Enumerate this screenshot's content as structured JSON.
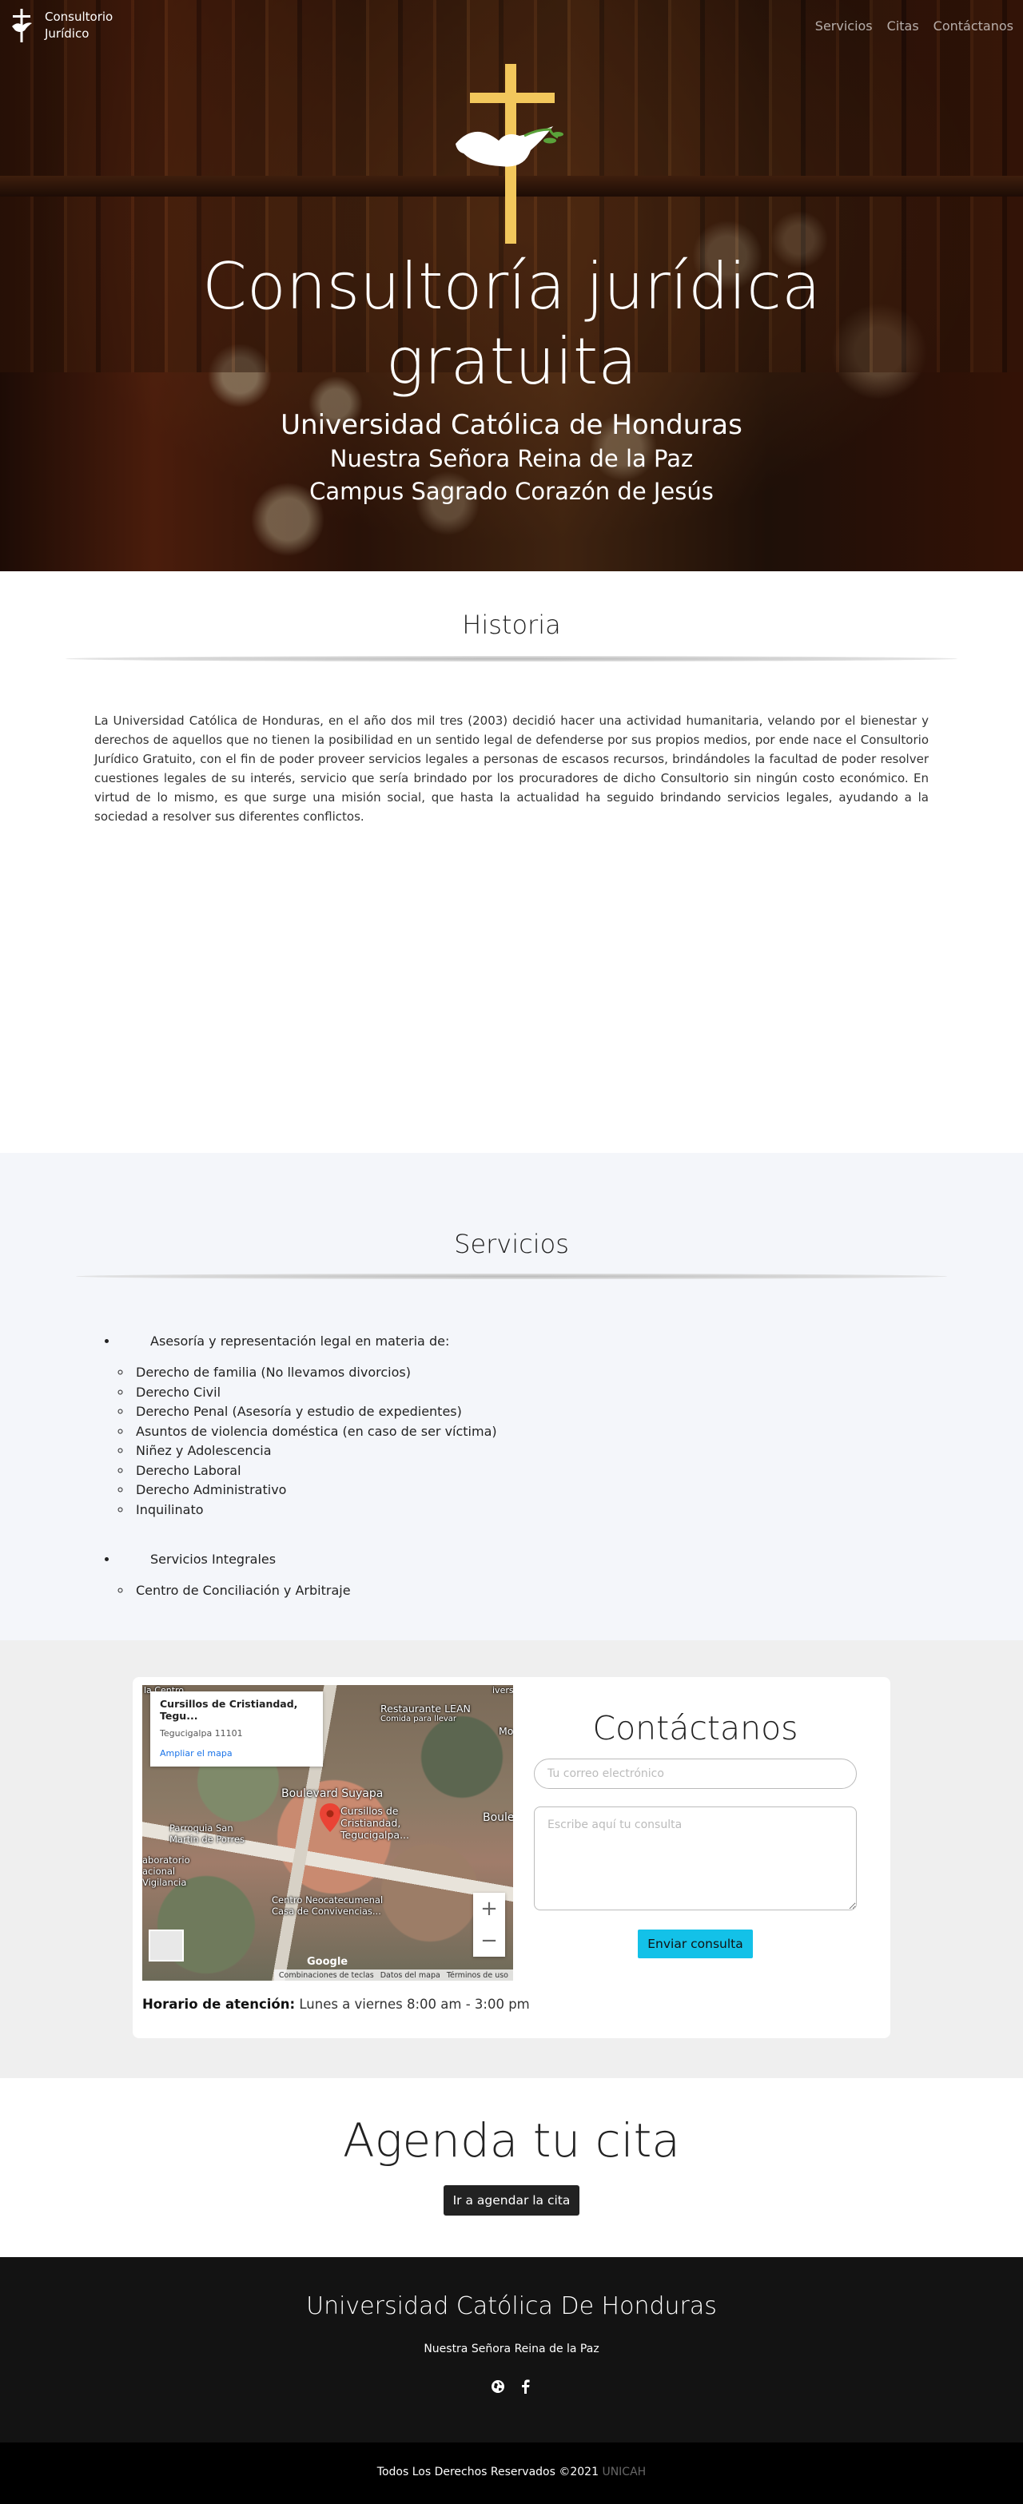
{
  "nav": {
    "brand": "Consultorio Jurídico",
    "links": [
      "Servicios",
      "Citas",
      "Contáctanos"
    ]
  },
  "hero": {
    "title": "Consultoría jurídica gratuita",
    "line1": "Universidad Católica de Honduras",
    "line2": "Nuestra Señora Reina de la Paz",
    "line3": "Campus Sagrado Corazón de Jesús"
  },
  "historia": {
    "title": "Historia",
    "text": "La Universidad Católica de Honduras, en el año dos mil tres (2003) decidió hacer una actividad humanitaria, velando por el bienestar y derechos de aquellos que no tienen la posibilidad en un sentido legal de defenderse por sus propios medios, por ende nace el Consultorio Jurídico Gratuito, con el fin de poder proveer servicios legales a personas de escasos recursos, brindándoles la facultad de poder resolver cuestiones legales de su interés, servicio que sería brindado por los procuradores de dicho Consultorio sin ningún costo económico. En virtud de lo mismo, es que surge una misión social, que hasta la actualidad ha seguido brindando servicios legales, ayudando a la sociedad a resolver sus diferentes conflictos."
  },
  "servicios": {
    "title": "Servicios",
    "groups": [
      {
        "label": "Asesoría y representación legal en materia de:",
        "items": [
          "Derecho de familia (No llevamos divorcios)",
          "Derecho Civil",
          "Derecho Penal (Asesoría y estudio de expedientes)",
          "Asuntos de violencia doméstica (en caso de ser víctima)",
          "Niñez y Adolescencia",
          "Derecho Laboral",
          "Derecho Administrativo",
          "Inquilinato"
        ]
      },
      {
        "label": "Servicios Integrales",
        "items": [
          "Centro de Conciliación y Arbitraje"
        ]
      }
    ]
  },
  "map": {
    "place_title": "Cursillos de Cristiandad, Tegu...",
    "address": "Tegucigalpa 11101",
    "enlarge_link": "Ampliar el mapa",
    "labels": {
      "restaurant": "Restaurante LEAN",
      "restaurant_sub": "Comida para llevar",
      "boulevard": "Boulevard Suyapa",
      "boulevard_right": "Boule",
      "pin": "Cursillos de Cristiandad, Tegucigalpa...",
      "parroquia": "Parroquia San Martin de Porres",
      "laboratorio": "aboratorio acional Vigilancia",
      "centro": "Centro Neocatecumenal Casa de Convivencias...",
      "top_left": "la Centro",
      "top_right": "ivers",
      "right_edge": "Mo"
    },
    "google": "Google",
    "footer": [
      "Combinaciones de teclas",
      "Datos del mapa",
      "Términos de uso"
    ]
  },
  "horario": {
    "label": "Horario de atención:",
    "value": "Lunes a viernes 8:00 am - 3:00 pm"
  },
  "contact": {
    "title": "Contáctanos",
    "email_placeholder": "Tu correo electrónico",
    "message_placeholder": "Escribe aquí tu consulta",
    "submit": "Enviar consulta"
  },
  "agenda": {
    "title": "Agenda tu cita",
    "button": "Ir a agendar la cita"
  },
  "footer": {
    "title": "Universidad Católica De Honduras",
    "subtitle": "Nuestra Señora Reina de la Paz",
    "icons": [
      "globe-icon",
      "facebook-icon"
    ],
    "copyright": "Todos Los Derechos Reservados ©2021",
    "unicah": "UNICAH"
  },
  "colors": {
    "accent": "#13c1e8",
    "cross": "#f2c75c",
    "footer_bg": "#131313"
  }
}
